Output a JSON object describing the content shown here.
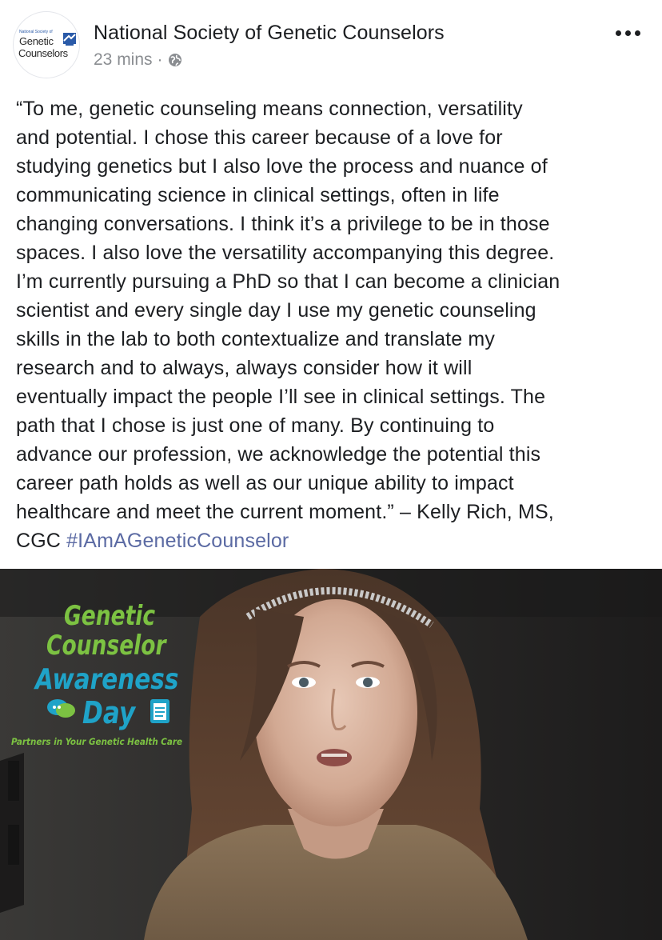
{
  "post": {
    "page_name": "National Society of Genetic Counselors",
    "time": "23 mins",
    "separator": "·",
    "avatar": {
      "small_text": "National Society of",
      "line1": "Genetic",
      "line2": "Counselors"
    },
    "text_lines": [
      "“To me, genetic counseling means connection, versatility",
      "and potential. I chose this career because of a love for",
      "studying genetics but I also love the process and nuance of",
      "communicating science in clinical settings, often in life",
      "changing conversations. I think it’s a privilege to be in those",
      "spaces. I also love the versatility accompanying this degree.",
      "I’m currently pursuing a PhD so that I can become a clinician",
      "scientist and every single day I use my genetic counseling",
      "skills in the lab to both contextualize and translate my",
      "research and to always, always consider how it will",
      "eventually impact the people I’ll see in clinical settings. The",
      "path that I chose is just one of many. By continuing to",
      "advance our profession, we acknowledge the potential this",
      "career path holds as well as our unique ability to impact",
      "healthcare and meet the current moment.” – Kelly Rich, MS,"
    ],
    "last_line_prefix": "CGC ",
    "hashtag": "#IAmAGeneticCounselor"
  },
  "video": {
    "banner": {
      "line1": "Genetic",
      "line2": "Counselor",
      "line3": "Awareness",
      "line4": "Day",
      "tagline": "Partners in Your Genetic Health Care"
    }
  },
  "colors": {
    "banner_green": "#7cc242",
    "banner_blue": "#1fa3c8",
    "hashtag": "#5b6aa3",
    "meta_gray": "#8a8d91"
  },
  "icons": {
    "privacy": "globe-icon",
    "options": "more-options-icon"
  }
}
